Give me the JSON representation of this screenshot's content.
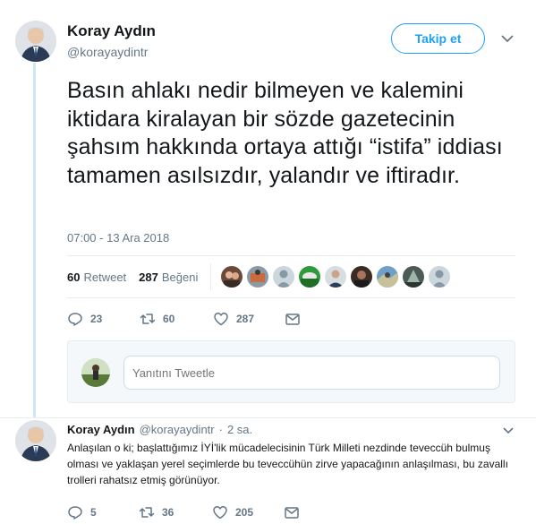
{
  "tweet": {
    "author_name": "Koray Aydın",
    "author_handle": "@korayaydintr",
    "follow_label": "Takip et",
    "text": "Basın ahlakı nedir bilmeyen ve kalemini iktidara kiralayan bir sözde gazetecinin şahsım hakkında ortaya attığı “istifa” iddiası tamamen asılsızdır, yalandır ve iftiradır.",
    "timestamp": "07:00 - 13 Ara 2018",
    "retweet_count": "60",
    "retweet_label": "Retweet",
    "like_count": "287",
    "like_label": "Beğeni",
    "actions": {
      "reply_count": "23",
      "retweet_count": "60",
      "like_count": "287"
    }
  },
  "reply_composer": {
    "placeholder": "Yanıtını Tweetle"
  },
  "reply": {
    "author_name": "Koray Aydın",
    "author_handle": "@korayaydintr",
    "separator": "·",
    "time_ago": "2 sa.",
    "text": "Anlaşılan o ki; başlattığımız İYİ'lik mücadelecisinin Türk Milleti nezdinde teveccüh bulmuş olması ve yaklaşan yerel seçimlerde bu teveccühün zirve yapacağının anlaşılması, bu zavallı trolleri rahatsız etmiş görünüyor.",
    "actions": {
      "reply_count": "5",
      "retweet_count": "36",
      "like_count": "205"
    }
  },
  "colors": {
    "accent": "#1da1f2",
    "text_primary": "#14171a",
    "text_secondary": "#657786",
    "thread_line": "#cfe6f5"
  }
}
